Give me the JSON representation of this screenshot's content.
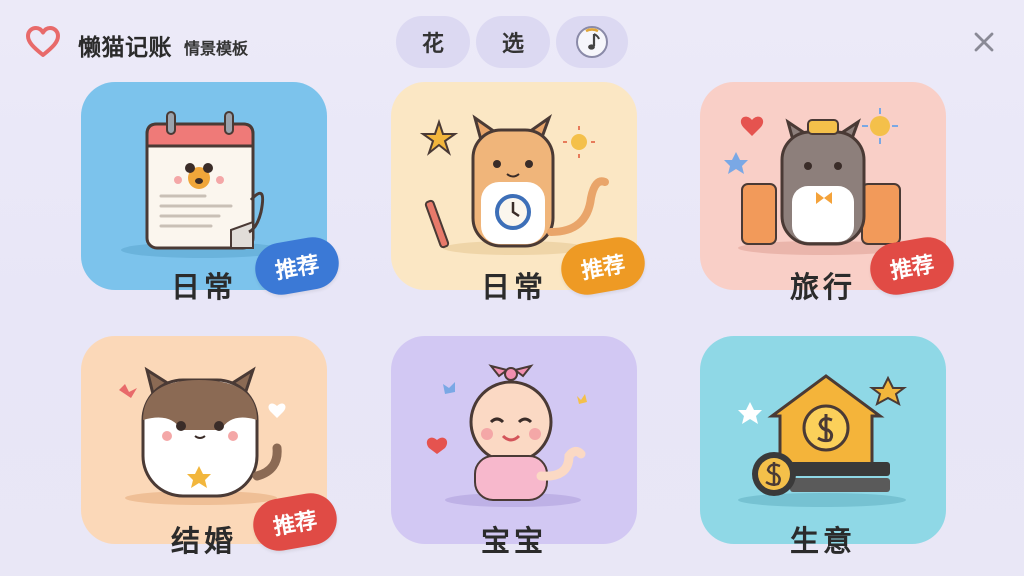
{
  "app": {
    "title": "懒猫记账",
    "subtitle": "情景模板",
    "heart_color": "#e86a6a"
  },
  "toolbar": {
    "flower_label": "花",
    "select_label": "选",
    "music_icon": "music-note-icon"
  },
  "cards": [
    {
      "label": "日常",
      "badge": "推荐",
      "bg": "#7cc3ec",
      "badge_color": "#3b79d6"
    },
    {
      "label": "日常",
      "badge": "推荐",
      "bg": "#fbe7c4",
      "badge_color": "#ee9a24"
    },
    {
      "label": "旅行",
      "badge": "推荐",
      "bg": "#f9cfc7",
      "badge_color": "#e14b45"
    },
    {
      "label": "结婚",
      "badge": "推荐",
      "bg": "#fbd8b8",
      "badge_color": "#e04b45"
    },
    {
      "label": "宝宝",
      "bg": "#d2c8f3"
    },
    {
      "label": "生意",
      "bg": "#8fd8e6"
    }
  ]
}
